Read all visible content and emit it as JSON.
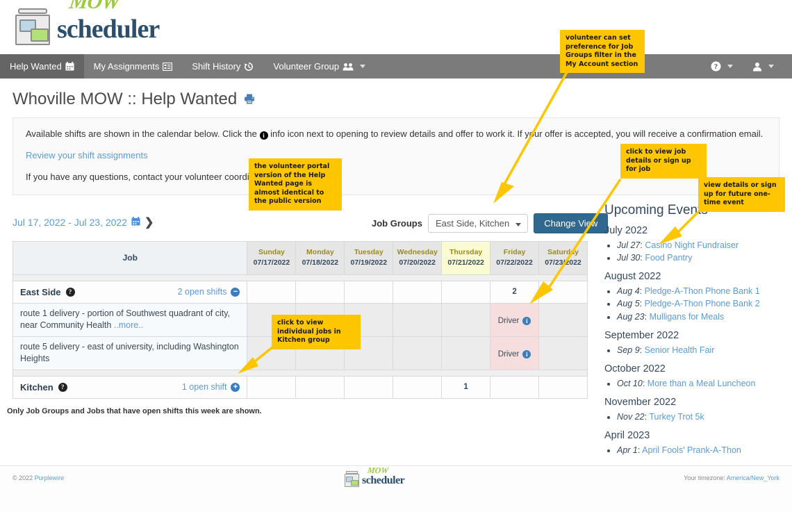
{
  "brand": {
    "mow": "MOW",
    "scheduler": "scheduler"
  },
  "nav": {
    "items": [
      {
        "label": "Help Wanted",
        "icon": "calendar-icon",
        "active": true
      },
      {
        "label": "My Assignments",
        "icon": "list-icon",
        "active": false
      },
      {
        "label": "Shift History",
        "icon": "history-icon",
        "active": false
      },
      {
        "label": "Volunteer Group",
        "icon": "people-icon",
        "active": false,
        "caret": true
      }
    ],
    "right": [
      {
        "label": "",
        "icon": "help-circle-icon",
        "caret": true
      },
      {
        "label": "",
        "icon": "user-icon",
        "caret": true
      }
    ]
  },
  "page": {
    "title": "Whoville MOW :: Help Wanted",
    "print_icon": "printer-icon"
  },
  "info_panel": {
    "line1_part1": "Available shifts are shown in the calendar below. Click the",
    "line1_part2": "info icon next to opening to review details and offer to work it. If your offer is accepted, you will receive a confirmation email.",
    "link": "Review your shift assignments",
    "line3": "If you have any questions, contact your volunteer coordinator."
  },
  "controls": {
    "date_range": "Jul 17, 2022 - Jul 23, 2022",
    "calendar_icon": "calendar-icon",
    "next_icon": "chevron-right-icon",
    "job_groups_label": "Job Groups",
    "job_groups_value": "East Side, Kitchen",
    "change_view_label": "Change View"
  },
  "calendar": {
    "job_header": "Job",
    "days": [
      {
        "dow": "Sunday",
        "date": "07/17/2022",
        "today": false
      },
      {
        "dow": "Monday",
        "date": "07/18/2022",
        "today": false
      },
      {
        "dow": "Tuesday",
        "date": "07/19/2022",
        "today": false
      },
      {
        "dow": "Wednesday",
        "date": "07/20/2022",
        "today": false
      },
      {
        "dow": "Thursday",
        "date": "07/21/2022",
        "today": true
      },
      {
        "dow": "Friday",
        "date": "07/22/2022",
        "today": false
      },
      {
        "dow": "Saturday",
        "date": "07/23/2022",
        "today": false
      }
    ],
    "groups": [
      {
        "name": "East Side",
        "open_shifts_label": "2 open shifts",
        "toggle": "minus",
        "counts": [
          "",
          "",
          "",
          "",
          "",
          "2",
          ""
        ],
        "jobs": [
          {
            "name": "route 1 delivery - portion of Southwest quadrant of city, near Community Health",
            "more": "..more..",
            "cells": [
              "",
              "",
              "",
              "",
              "",
              "Driver",
              ""
            ]
          },
          {
            "name": "route 5 delivery - east of university, including Washington Heights",
            "more": "",
            "cells": [
              "",
              "",
              "",
              "",
              "",
              "Driver",
              ""
            ]
          }
        ]
      },
      {
        "name": "Kitchen",
        "open_shifts_label": "1 open shift",
        "toggle": "plus",
        "counts": [
          "",
          "",
          "",
          "",
          "1",
          "",
          ""
        ],
        "jobs": []
      }
    ],
    "note": "Only Job Groups and Jobs that have open shifts this week are shown."
  },
  "events": {
    "title": "Upcoming Events",
    "months": [
      {
        "month": "July 2022",
        "items": [
          {
            "date": "Jul 27",
            "name": "Casino Night Fundraiser"
          },
          {
            "date": "Jul 30",
            "name": "Food Pantry"
          }
        ]
      },
      {
        "month": "August 2022",
        "items": [
          {
            "date": "Aug 4",
            "name": "Pledge-A-Thon Phone Bank 1"
          },
          {
            "date": "Aug 5",
            "name": "Pledge-A-Thon Phone Bank 2"
          },
          {
            "date": "Aug 23",
            "name": "Mulligans for Meals"
          }
        ]
      },
      {
        "month": "September 2022",
        "items": [
          {
            "date": "Sep 9",
            "name": "Senior Health Fair"
          }
        ]
      },
      {
        "month": "October 2022",
        "items": [
          {
            "date": "Oct 10",
            "name": "More than a Meal Luncheon"
          }
        ]
      },
      {
        "month": "November 2022",
        "items": [
          {
            "date": "Nov 22",
            "name": "Turkey Trot 5k"
          }
        ]
      },
      {
        "month": "April 2023",
        "items": [
          {
            "date": "Apr 1",
            "name": "April Fools' Prank-A-Thon"
          }
        ]
      }
    ]
  },
  "footer": {
    "copyright_prefix": "© 2022 ",
    "copyright_link": "Purplewire",
    "timezone_prefix": "Your timezone: ",
    "timezone_link": "America/New_York"
  },
  "annotations": [
    {
      "id": "a1",
      "text": "volunteer can set preference for Job Groups filter in the My Account section"
    },
    {
      "id": "a2",
      "text": "the volunteer portal version of the Help Wanted page is almost identical to the public version"
    },
    {
      "id": "a3",
      "text": "click to view job details or sign up for job"
    },
    {
      "id": "a4",
      "text": "view details or sign up for future one-time event"
    },
    {
      "id": "a5",
      "text": "click to view individual jobs in Kitchen group"
    }
  ],
  "colors": {
    "annotation_bg": "#FDC600",
    "nav_bg": "#7b7b7b",
    "nav_active": "#656565",
    "primary_button": "#31688e",
    "link": "#5b9bd5",
    "shift_cell": "#f6dede",
    "today_header": "#fbfbd3"
  }
}
